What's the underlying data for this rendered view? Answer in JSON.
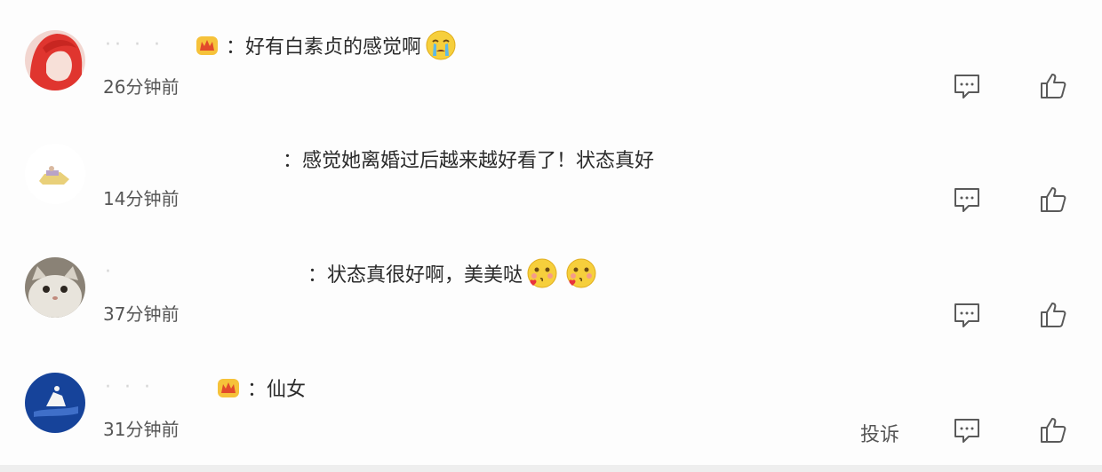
{
  "comments": [
    {
      "username": "·· ·  ·",
      "text": "：好有白素贞的感觉啊",
      "time": "26分钟前",
      "badge": "vip-crown-icon",
      "emojis": [
        "crying-face-icon"
      ]
    },
    {
      "username": "",
      "text": "：感觉她离婚过后越来越好看了！状态真好",
      "time": "14分钟前",
      "badge": "",
      "emojis": []
    },
    {
      "username": "·",
      "text": "：状态真很好啊，美美哒",
      "time": "37分钟前",
      "badge": "",
      "emojis": [
        "blowing-kiss-icon",
        "blowing-kiss-icon"
      ]
    },
    {
      "username": "· ·  ·",
      "text": "：仙女",
      "time": "31分钟前",
      "badge": "vip-crown-icon",
      "emojis": []
    }
  ],
  "actions": {
    "reply_icon": "comment-icon",
    "like_icon": "thumbs-up-icon",
    "report_label": "投诉"
  },
  "colors": {
    "text": "#2a2a2a",
    "meta": "#555555",
    "icon": "#5a5a5a"
  }
}
